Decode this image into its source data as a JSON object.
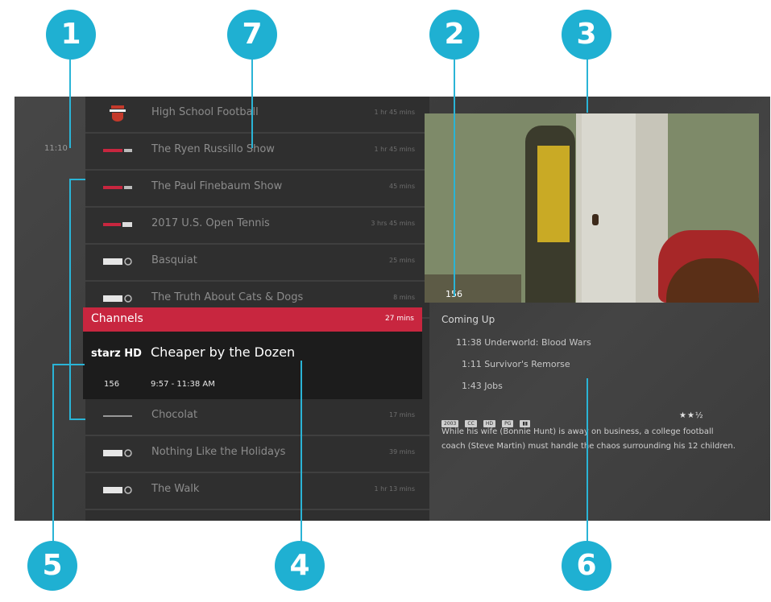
{
  "clock": "11:10",
  "channel_list": [
    {
      "title": "High School Football",
      "duration": "1 hr 45 mins",
      "logo": "school-u-logo"
    },
    {
      "title": "The Ryen Russillo Show",
      "duration": "1 hr 45 mins",
      "logo": "espn-logo"
    },
    {
      "title": "The Paul Finebaum Show",
      "duration": "45 mins",
      "logo": "espn-logo"
    },
    {
      "title": "2017 U.S. Open Tennis",
      "duration": "3 hrs 45 mins",
      "logo": "espn-hd-logo"
    },
    {
      "title": "Basquiat",
      "duration": "25 mins",
      "logo": "starz-hd-logo"
    },
    {
      "title": "The Truth About Cats & Dogs",
      "duration": "8 mins",
      "logo": "starz-hd-logo"
    },
    {
      "title": "Chocolat",
      "duration": "17 mins",
      "logo": "network-logo"
    },
    {
      "title": "Nothing Like the Holidays",
      "duration": "39 mins",
      "logo": "starz-hd-logo"
    },
    {
      "title": "The Walk",
      "duration": "1 hr 13 mins",
      "logo": "starz-hd-logo"
    }
  ],
  "channels_bar": {
    "label": "Channels",
    "duration": "27 mins",
    "color": "#c8263f"
  },
  "selected": {
    "logo": "starz-hd-logo",
    "logo_text": "starz HD",
    "title": "Cheaper by the Dozen",
    "channel": "156",
    "time": "9:57 - 11:38 AM"
  },
  "preview": {
    "channel": "156"
  },
  "coming_up": {
    "heading": "Coming Up",
    "items": [
      {
        "time": "11:38",
        "title": "Underworld: Blood Wars"
      },
      {
        "time": "1:11",
        "title": "Survivor's Remorse"
      },
      {
        "time": "1:43",
        "title": "Jobs"
      }
    ]
  },
  "badges": [
    "2003",
    "CC",
    "HD",
    "PG",
    "▮▮"
  ],
  "rating_stars": "★★½",
  "description": "While his wife (Bonnie Hunt) is away on business, a college football coach (Steve Martin) must handle the chaos surrounding his 12 children.",
  "callouts": [
    "1",
    "2",
    "3",
    "4",
    "5",
    "6",
    "7"
  ],
  "accent_color": "#1fb0d2"
}
